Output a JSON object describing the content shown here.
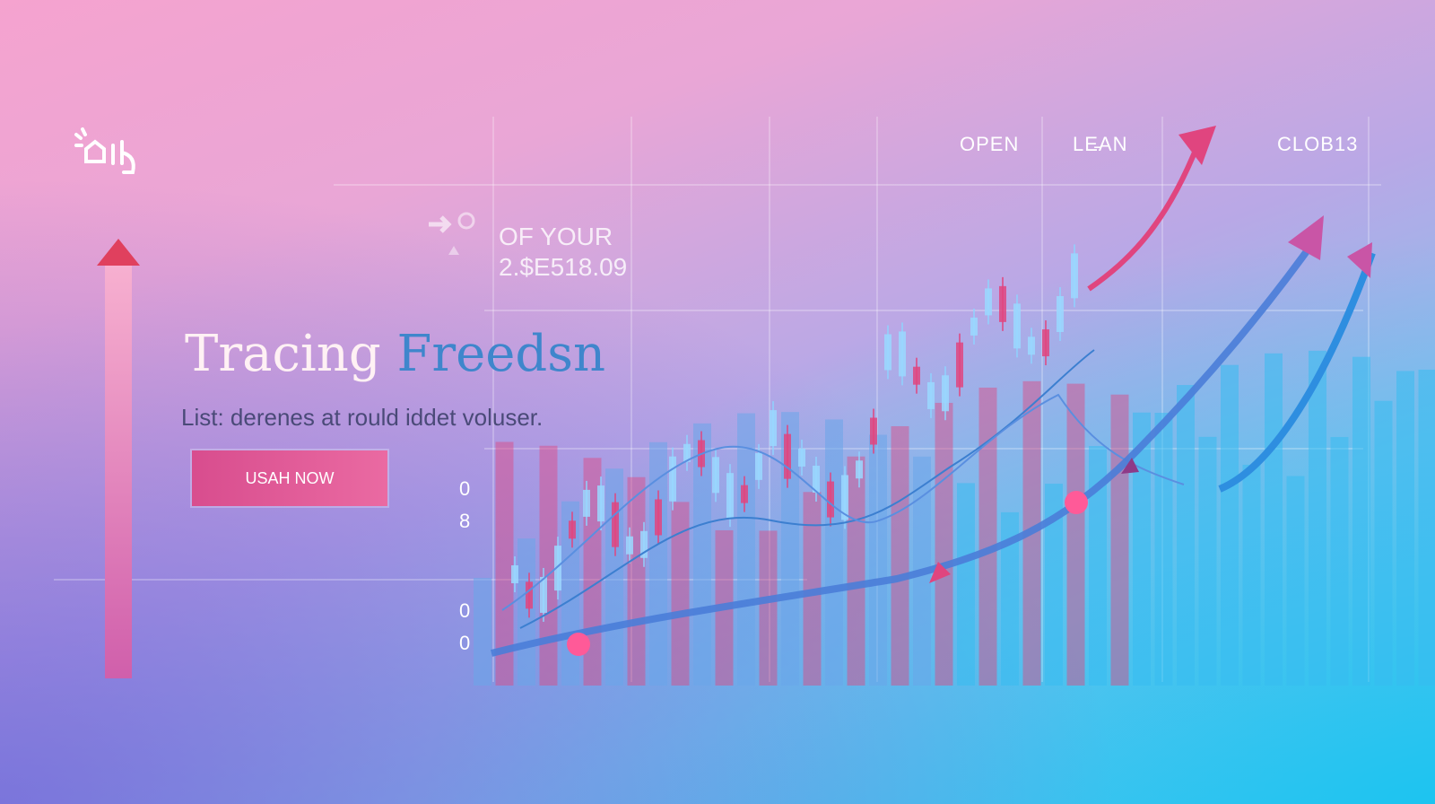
{
  "header": {
    "col1": "OPEN",
    "col2": "LE̵AN",
    "col3": "CLOB13"
  },
  "stat": {
    "label": "OF YOUR",
    "value": "2.$E518.09"
  },
  "hero": {
    "title_part1": "Tracing",
    "title_part2": "Freedsn",
    "subtitle": "List: derenes at rould iddet voluser."
  },
  "cta": {
    "label": "USAH NOW"
  },
  "y_labels": [
    "0",
    "8",
    "0",
    "0"
  ],
  "colors": {
    "accent": "#e0457f",
    "blue": "#3f86cc",
    "cyan": "#2fc3f2"
  },
  "icons": {
    "logo": "brand-logo-icon",
    "arrow_up": "trend-up-arrow-icon"
  }
}
